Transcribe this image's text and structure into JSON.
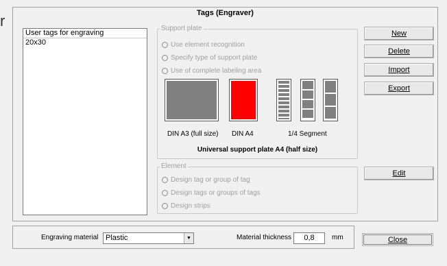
{
  "stray_char": "r",
  "window": {
    "title": "Tags (Engraver)"
  },
  "tag_list": {
    "header": "User tags for engraving",
    "items": [
      "20x30"
    ]
  },
  "support_plate": {
    "legend": "Support plate",
    "options": [
      "Use element recognition",
      "Specify type of support plate",
      "Use of complete labeling area"
    ],
    "captions": {
      "a3": "DIN A3 (full size)",
      "a4": "DIN A4",
      "segment": "1/4 Segment"
    },
    "title": "Universal support plate A4 (half size)",
    "colors": {
      "a3": "#808080",
      "a4": "#ff0000"
    }
  },
  "element": {
    "legend": "Element",
    "options": [
      "Design tag or group of tag",
      "Design tags or groups of tags",
      "Design strips"
    ]
  },
  "buttons": {
    "new": "New",
    "delete": "Delete",
    "import": "Import",
    "export": "Export",
    "edit": "Edit",
    "close": "Close"
  },
  "material": {
    "label": "Engraving material",
    "value": "Plastic"
  },
  "thickness": {
    "label": "Material thickness",
    "value": "0,8",
    "unit": "mm"
  }
}
